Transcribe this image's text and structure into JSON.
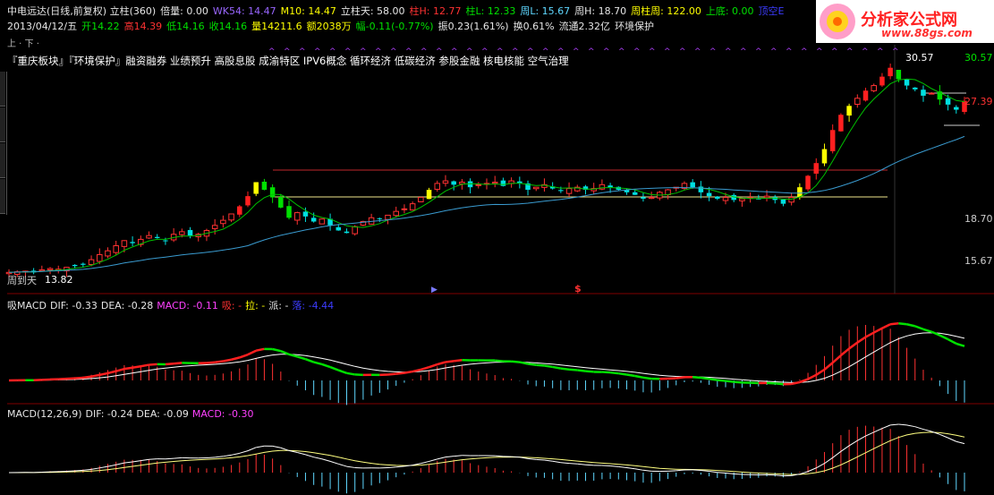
{
  "header1": [
    {
      "text": "中电远达(日线,前复权) 立柱(360)",
      "cls": "w",
      "name": "security-title"
    },
    {
      "text": "倍量: 0.00",
      "cls": "w",
      "name": "ind-beiliang"
    },
    {
      "text": "WK54: 14.47",
      "cls": "vio",
      "name": "ind-wk54"
    },
    {
      "text": "M10: 14.47",
      "cls": "y",
      "name": "ind-m10"
    },
    {
      "text": "立柱天: 58.00",
      "cls": "w",
      "name": "ind-lizhutian"
    },
    {
      "text": "柱H: 12.77",
      "cls": "r",
      "name": "ind-zhuh"
    },
    {
      "text": "柱L: 12.33",
      "cls": "g",
      "name": "ind-zhul"
    },
    {
      "text": "周L: 15.67",
      "cls": "c",
      "name": "ind-zhoul"
    },
    {
      "text": "周H: 18.70",
      "cls": "w",
      "name": "ind-zhouh"
    },
    {
      "text": "周柱周: 122.00",
      "cls": "y",
      "name": "ind-zhouzhuzhou"
    },
    {
      "text": "上底: 0.00",
      "cls": "g",
      "name": "ind-shangdi"
    },
    {
      "text": "顶空E",
      "cls": "b",
      "name": "ind-dingkong"
    }
  ],
  "header2": [
    {
      "text": "2013/04/12/五",
      "cls": "w",
      "name": "bar-date"
    },
    {
      "text": "开14.22",
      "cls": "g",
      "name": "bar-open"
    },
    {
      "text": "高14.39",
      "cls": "r",
      "name": "bar-high"
    },
    {
      "text": "低14.16",
      "cls": "g",
      "name": "bar-low"
    },
    {
      "text": "收14.16",
      "cls": "g",
      "name": "bar-close"
    },
    {
      "text": "量14211.6",
      "cls": "y",
      "name": "bar-volume"
    },
    {
      "text": "额2038万",
      "cls": "y",
      "name": "bar-amount"
    },
    {
      "text": "幅-0.11(-0.77%)",
      "cls": "g",
      "name": "bar-change"
    },
    {
      "text": "振0.23(1.61%)",
      "cls": "w",
      "name": "bar-amplitude"
    },
    {
      "text": "换0.61%",
      "cls": "w",
      "name": "bar-turnover"
    },
    {
      "text": "流通2.32亿",
      "cls": "w",
      "name": "bar-float"
    },
    {
      "text": "环境保护",
      "cls": "w",
      "name": "bar-sector"
    }
  ],
  "updown": "上 · 下 ·",
  "concepts": "『重庆板块』『环境保护』融资融券 业绩预升 高股息股 成渝特区 IPV6概念 循环经济 低碳经济 参股金融 核电核能 空气治理",
  "price_labels": {
    "top_left": "30.57",
    "top_right": "30.57",
    "right_mid": "27.39",
    "p1": "18.70",
    "p2": "15.67",
    "bottom_left": "13.82",
    "annotation": "周到天"
  },
  "panel1": [
    {
      "text": "吸MACD",
      "cls": "w",
      "name": "p1-title"
    },
    {
      "text": "DIF: -0.33",
      "cls": "w",
      "name": "p1-dif"
    },
    {
      "text": "DEA: -0.28",
      "cls": "w",
      "name": "p1-dea"
    },
    {
      "text": "MACD: -0.11",
      "cls": "m",
      "name": "p1-macd"
    },
    {
      "text": "吸: -",
      "cls": "r",
      "name": "p1-xi"
    },
    {
      "text": "拉: -",
      "cls": "y",
      "name": "p1-la"
    },
    {
      "text": "派: -",
      "cls": "w",
      "name": "p1-pai"
    },
    {
      "text": "落: -4.44",
      "cls": "b",
      "name": "p1-luo"
    }
  ],
  "panel2": [
    {
      "text": "MACD(12,26,9)",
      "cls": "w",
      "name": "p2-title"
    },
    {
      "text": "DIF: -0.24",
      "cls": "w",
      "name": "p2-dif"
    },
    {
      "text": "DEA: -0.09",
      "cls": "w",
      "name": "p2-dea"
    },
    {
      "text": "MACD: -0.30",
      "cls": "m",
      "name": "p2-macd"
    }
  ],
  "markers": {
    "dollar": "$"
  },
  "logo": {
    "title": "分析家公式网",
    "url": "www.88gs.com"
  },
  "colors": {
    "up": "#ff3232",
    "down": "#00e000",
    "yellow": "#ffff00",
    "ma": "#00c000",
    "ma_long": "#3a9bd0",
    "bg": "#000000",
    "divider": "#800000"
  },
  "chart_data": {
    "type": "candlestick",
    "closes": [
      13.9,
      13.95,
      14.0,
      13.9,
      14.1,
      14.2,
      14.15,
      14.3,
      14.4,
      14.5,
      14.9,
      15.3,
      15.6,
      16.0,
      16.4,
      16.2,
      16.5,
      16.8,
      16.6,
      16.4,
      16.9,
      17.1,
      16.8,
      16.9,
      17.2,
      17.6,
      18.0,
      18.5,
      19.1,
      19.9,
      21.0,
      20.4,
      19.8,
      19.0,
      18.2,
      18.6,
      18.3,
      17.9,
      18.1,
      17.6,
      17.2,
      17.0,
      17.5,
      17.9,
      18.2,
      18.1,
      18.4,
      18.7,
      18.9,
      19.3,
      19.8,
      20.4,
      20.9,
      21.1,
      20.8,
      21.0,
      20.6,
      20.8,
      20.9,
      21.0,
      20.7,
      21.1,
      20.9,
      20.4,
      20.6,
      20.8,
      20.5,
      20.3,
      20.5,
      20.6,
      20.4,
      20.5,
      20.8,
      20.6,
      20.4,
      20.2,
      20.0,
      19.7,
      19.8,
      20.2,
      20.4,
      20.6,
      20.9,
      20.6,
      20.2,
      19.9,
      19.7,
      19.8,
      19.6,
      19.7,
      19.8,
      19.7,
      19.9,
      19.6,
      19.3,
      19.8,
      20.6,
      21.5,
      22.5,
      23.6,
      25.1,
      26.3,
      27.0,
      27.6,
      28.2,
      28.6,
      29.3,
      30.0,
      29.1,
      28.6,
      28.3,
      27.8,
      28.0,
      27.5,
      27.1,
      26.7,
      27.4
    ]
  }
}
